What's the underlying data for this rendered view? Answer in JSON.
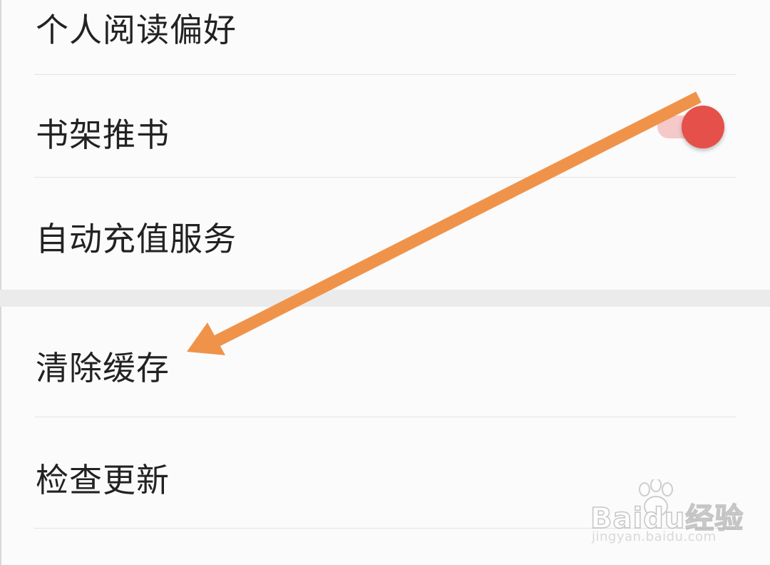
{
  "settings": {
    "items": [
      {
        "label": "个人阅读偏好"
      },
      {
        "label": "书架推书",
        "toggle": {
          "on": true
        }
      },
      {
        "label": "自动充值服务"
      },
      {
        "label": "清除缓存"
      },
      {
        "label": "检查更新"
      }
    ]
  },
  "colors": {
    "toggle_knob": "#e5504a",
    "toggle_track": "#f6c9c9",
    "annotation_arrow": "#f0934a",
    "text": "#222222",
    "background": "#fbfbfb"
  },
  "annotation": {
    "type": "arrow",
    "points_to": "清除缓存"
  },
  "watermark": {
    "brand": "Baidu经验",
    "url": "jingyan.baidu.com",
    "icon": "paw-icon"
  }
}
